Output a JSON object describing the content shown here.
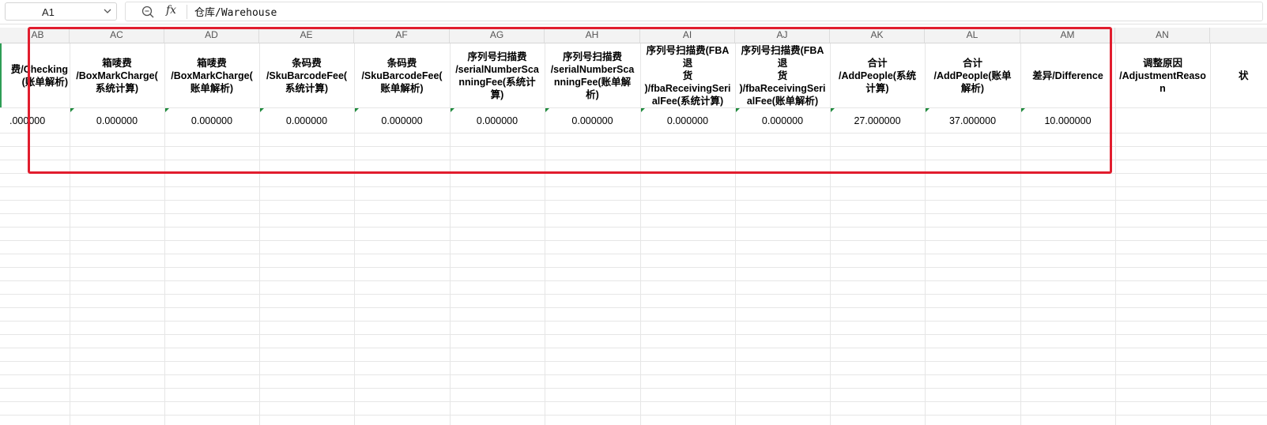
{
  "formula_bar": {
    "cell_ref": "A1",
    "fx_label": "fx",
    "content": "仓库/Warehouse"
  },
  "columns": [
    "AB",
    "AC",
    "AD",
    "AE",
    "AF",
    "AG",
    "AH",
    "AI",
    "AJ",
    "AK",
    "AL",
    "AM",
    "AN"
  ],
  "headers": [
    "费/Checking\n(账单解析)",
    "箱唛费\n/BoxMarkCharge(\n系统计算)",
    "箱唛费\n/BoxMarkCharge(\n账单解析)",
    "条码费\n/SkuBarcodeFee(\n系统计算)",
    "条码费\n/SkuBarcodeFee(\n账单解析)",
    "序列号扫描费\n/serialNumberSca\nnningFee(系统计\n算)",
    "序列号扫描费\n/serialNumberSca\nnningFee(账单解\n析)",
    "序列号扫描费(FBA\n退\n货\n)/fbaReceivingSeri\nalFee(系统计算)",
    "序列号扫描费(FBA\n退\n货\n)/fbaReceivingSeri\nalFee(账单解析)",
    "合计\n/AddPeople(系统\n计算)",
    "合计\n/AddPeople(账单\n解析)",
    "差异/Difference",
    "调整原因\n/AdjustmentReaso\nn",
    "状"
  ],
  "values": [
    ".000000",
    "0.000000",
    "0.000000",
    "0.000000",
    "0.000000",
    "0.000000",
    "0.000000",
    "0.000000",
    "0.000000",
    "27.000000",
    "37.000000",
    "10.000000",
    "",
    ""
  ],
  "colors": {
    "highlight": "#e11d2e",
    "error_marker": "#1e8a3c"
  }
}
